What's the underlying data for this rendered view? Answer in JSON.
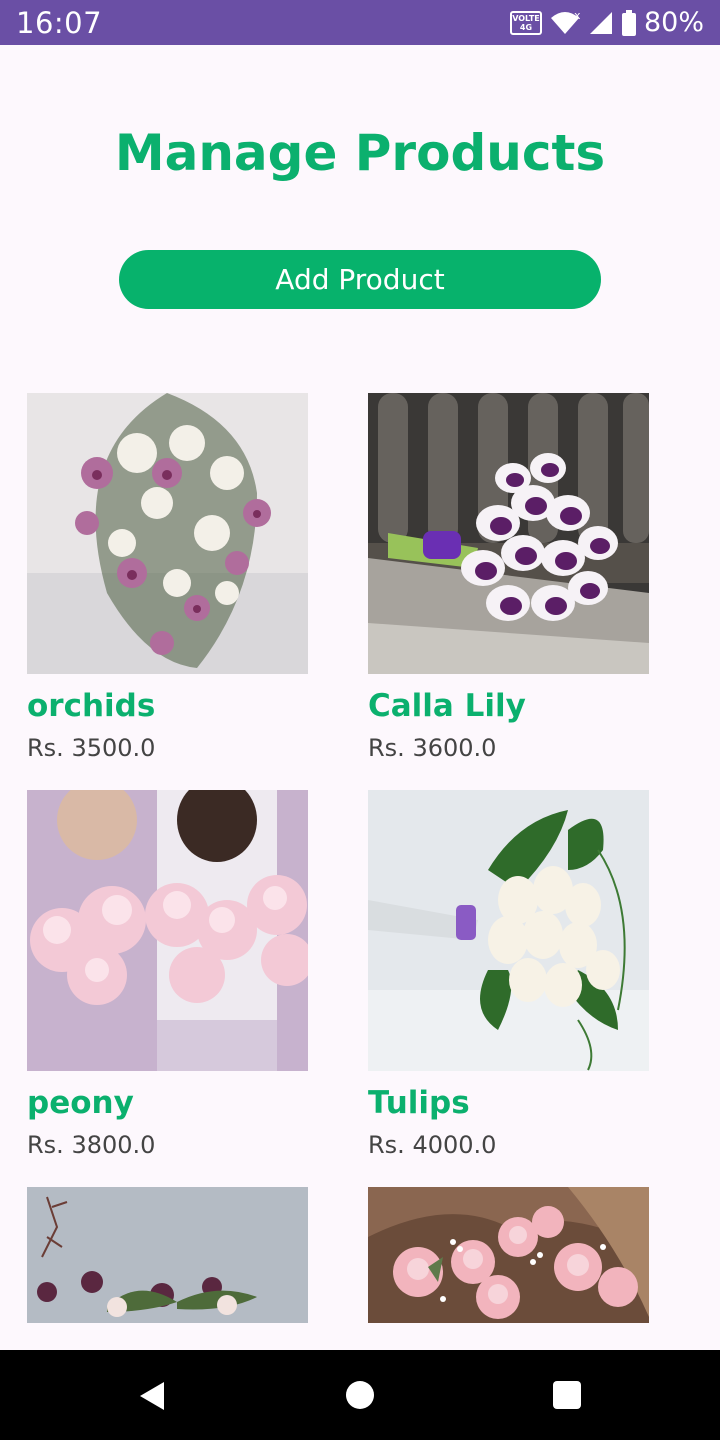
{
  "status_bar": {
    "time": "16:07",
    "volte_label_top": "VOLTE",
    "volte_label_bottom": "4G",
    "battery_percent": "80%",
    "icons": [
      "volte-icon",
      "wifi-icon",
      "signal-icon",
      "battery-icon"
    ]
  },
  "page": {
    "title": "Manage Products",
    "add_button_label": "Add Product"
  },
  "products": [
    {
      "name": "orchids",
      "price": "Rs. 3500.0",
      "image": "orchid-bouquet-image"
    },
    {
      "name": "Calla Lily",
      "price": "Rs. 3600.0",
      "image": "calla-lily-bouquet-image"
    },
    {
      "name": "peony",
      "price": "Rs. 3800.0",
      "image": "peony-bouquet-image"
    },
    {
      "name": "Tulips",
      "price": "Rs. 4000.0",
      "image": "tulip-bouquet-image"
    },
    {
      "name": "",
      "price": "",
      "image": "dark-flower-arrangement-image"
    },
    {
      "name": "",
      "price": "",
      "image": "pink-rose-bouquet-image"
    }
  ],
  "colors": {
    "accent": "#0bb06e",
    "button": "#07b26c",
    "status_bar": "#6a4fa5",
    "background": "#fdf8fd"
  },
  "navigation": {
    "icons": [
      "back-icon",
      "home-icon",
      "recents-icon"
    ]
  }
}
